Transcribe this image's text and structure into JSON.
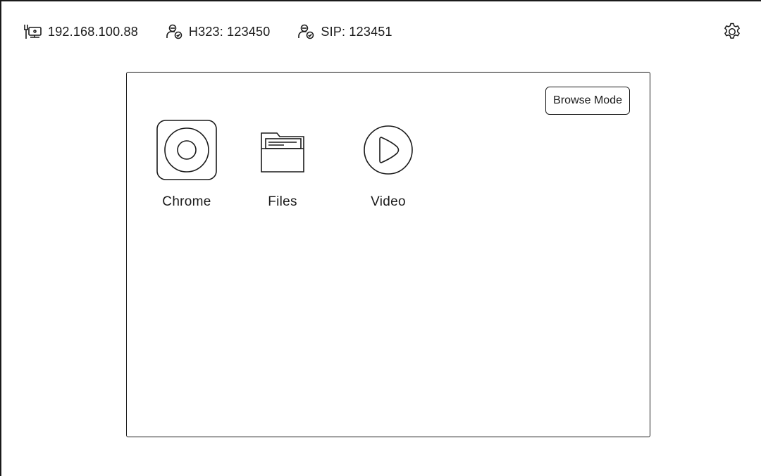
{
  "status_bar": {
    "ip": "192.168.100.88",
    "h323": "H323: 123450",
    "sip": "SIP: 123451"
  },
  "panel": {
    "browse_mode_label": "Browse Mode",
    "apps": [
      {
        "label": "Chrome",
        "icon": "chrome-icon"
      },
      {
        "label": "Files",
        "icon": "folder-icon"
      },
      {
        "label": "Video",
        "icon": "play-icon"
      }
    ]
  }
}
